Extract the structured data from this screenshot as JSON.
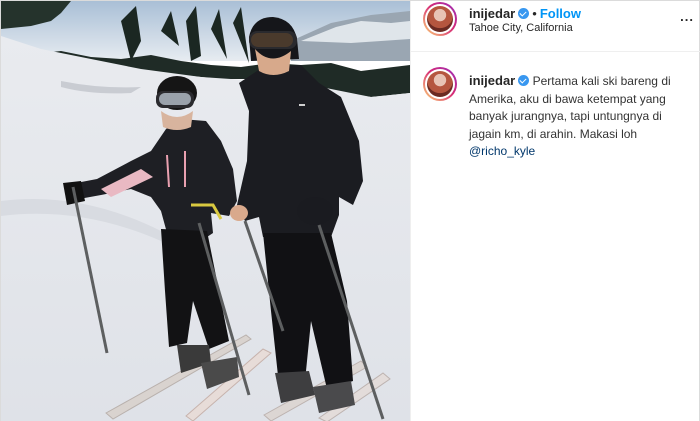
{
  "post": {
    "username": "inijedar",
    "separator": "•",
    "follow_label": "Follow",
    "location": "Tahoe City, California",
    "more_label": "...",
    "caption": {
      "username": "inijedar",
      "text": "Pertama kali ski bareng di Amerika, aku di bawa ketempat yang banyak jurangnya, tapi untungnya di jagain km, di arahin. Makasi loh",
      "mention": "@richo_kyle"
    }
  },
  "colors": {
    "follow": "#0095f6",
    "verified": "#3897f0",
    "mention": "#00376b",
    "border": "#dbdbdb"
  },
  "icons": [
    "verified-badge-icon",
    "more-options-icon"
  ]
}
